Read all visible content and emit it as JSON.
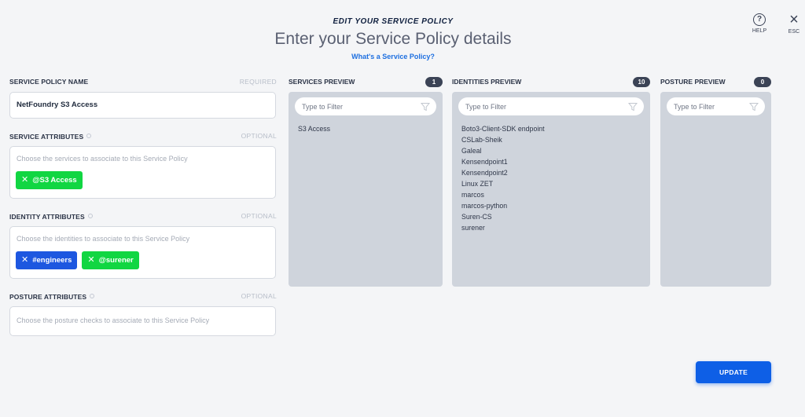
{
  "header": {
    "kicker": "EDIT YOUR SERVICE POLICY",
    "title": "Enter your Service Policy details",
    "link": "What's a Service Policy?"
  },
  "help": {
    "label": "HELP",
    "icon": "?"
  },
  "esc": {
    "label": "ESC",
    "icon": "×"
  },
  "form": {
    "name": {
      "label": "SERVICE POLICY NAME",
      "tag": "REQUIRED",
      "value": "NetFoundry S3 Access"
    },
    "service_attributes": {
      "label": "SERVICE ATTRIBUTES",
      "tag": "OPTIONAL",
      "placeholder": "Choose the services to associate to this Service Policy",
      "chips": [
        {
          "text": "@S3 Access",
          "color": "green"
        }
      ]
    },
    "identity_attributes": {
      "label": "IDENTITY ATTRIBUTES",
      "tag": "OPTIONAL",
      "placeholder": "Choose the identities to associate to this Service Policy",
      "chips": [
        {
          "text": "#engineers",
          "color": "blue"
        },
        {
          "text": "@surener",
          "color": "green"
        }
      ]
    },
    "posture_attributes": {
      "label": "POSTURE ATTRIBUTES",
      "tag": "OPTIONAL",
      "placeholder": "Choose the posture checks to associate to this Service Policy"
    }
  },
  "previews": {
    "services": {
      "title": "SERVICES PREVIEW",
      "count": "1",
      "filter_placeholder": "Type to Filter",
      "items": [
        "S3 Access"
      ]
    },
    "identities": {
      "title": "IDENTITIES PREVIEW",
      "count": "10",
      "filter_placeholder": "Type to Filter",
      "items": [
        "Boto3-Client-SDK endpoint",
        "CSLab-Sheik",
        "Galeal",
        "Kensendpoint1",
        "Kensendpoint2",
        "Linux ZET",
        "marcos",
        "marcos-python",
        "Suren-CS",
        "surener"
      ]
    },
    "posture": {
      "title": "POSTURE PREVIEW",
      "count": "0",
      "filter_placeholder": "Type to Filter",
      "items": []
    }
  },
  "actions": {
    "update_label": "UPDATE"
  },
  "colors": {
    "accent": "#0e5fe6",
    "chip_green": "#11d642",
    "chip_blue": "#1d57e0",
    "panel": "#cfd4dc"
  },
  "icons": {
    "help": "help-circle-icon",
    "close": "close-icon",
    "filter": "funnel-icon",
    "chip_remove": "x-icon",
    "info": "info-icon"
  }
}
